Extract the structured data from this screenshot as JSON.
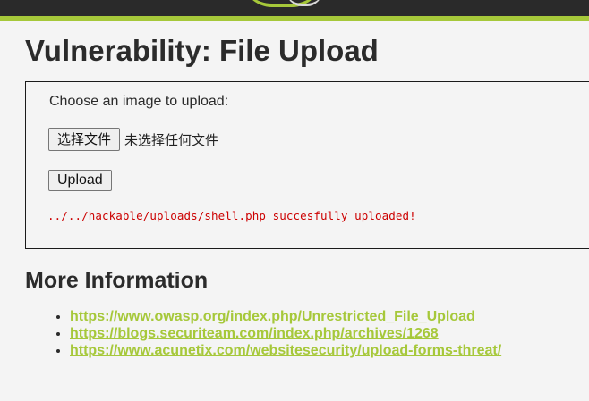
{
  "header": {
    "accent_color": "#a6c83a",
    "bar_color": "#2a2a2a"
  },
  "page": {
    "title": "Vulnerability: File Upload"
  },
  "upload": {
    "prompt": "Choose an image to upload:",
    "choose_file_label": "选择文件",
    "no_file_text": "未选择任何文件",
    "upload_button_label": "Upload",
    "result_message": "../../hackable/uploads/shell.php succesfully uploaded!",
    "result_color": "#cc0000"
  },
  "more_info": {
    "heading": "More Information",
    "links": [
      {
        "text": "https://www.owasp.org/index.php/Unrestricted_File_Upload"
      },
      {
        "text": "https://blogs.securiteam.com/index.php/archives/1268"
      },
      {
        "text": "https://www.acunetix.com/websitesecurity/upload-forms-threat/"
      }
    ]
  }
}
